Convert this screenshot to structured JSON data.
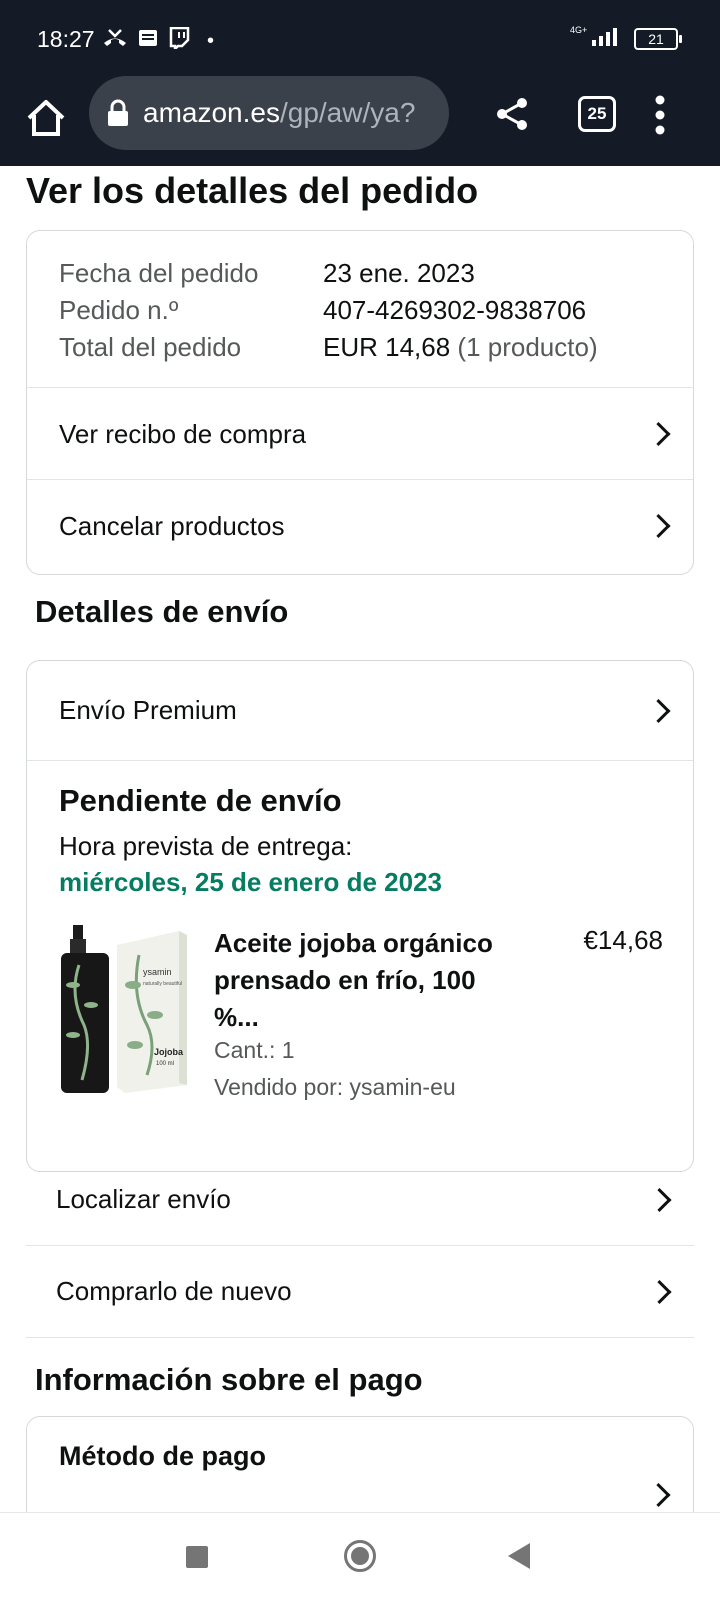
{
  "status_bar": {
    "time": "18:27",
    "network": "4G+",
    "battery": "21"
  },
  "browser": {
    "url_host": "amazon.es",
    "url_path": "/gp/aw/ya?",
    "tab_count": "25"
  },
  "page": {
    "title": "Ver los detalles del pedido"
  },
  "order_summary": {
    "date_label": "Fecha del pedido",
    "date_value": "23 ene. 2023",
    "number_label": "Pedido n.º",
    "number_value": "407-4269302-9838706",
    "total_label": "Total del pedido",
    "total_value": "EUR 14,68",
    "total_count": "(1 producto)"
  },
  "order_actions": {
    "receipt": "Ver recibo de compra",
    "cancel": "Cancelar productos"
  },
  "shipping": {
    "heading": "Detalles de envío",
    "method": "Envío Premium",
    "status": "Pendiente de envío",
    "eta_label": "Hora prevista de entrega:",
    "eta_date": "miércoles, 25 de enero de 2023",
    "product": {
      "name": "Aceite jojoba orgánico prensado en frío, 100 %...",
      "price": "€14,68",
      "qty": "Cant.: 1",
      "seller": "Vendido por: ysamin-eu",
      "box_brand": "ysamin",
      "box_tagline": "naturally beautiful",
      "box_name": "Jojoba",
      "box_volume": "100 ml"
    },
    "track": "Localizar envío",
    "buy_again": "Comprarlo de nuevo"
  },
  "payment": {
    "heading": "Información sobre el pago",
    "method_label": "Método de pago"
  },
  "colors": {
    "eta_green": "#067d62",
    "browser_bar": "#141b27"
  }
}
